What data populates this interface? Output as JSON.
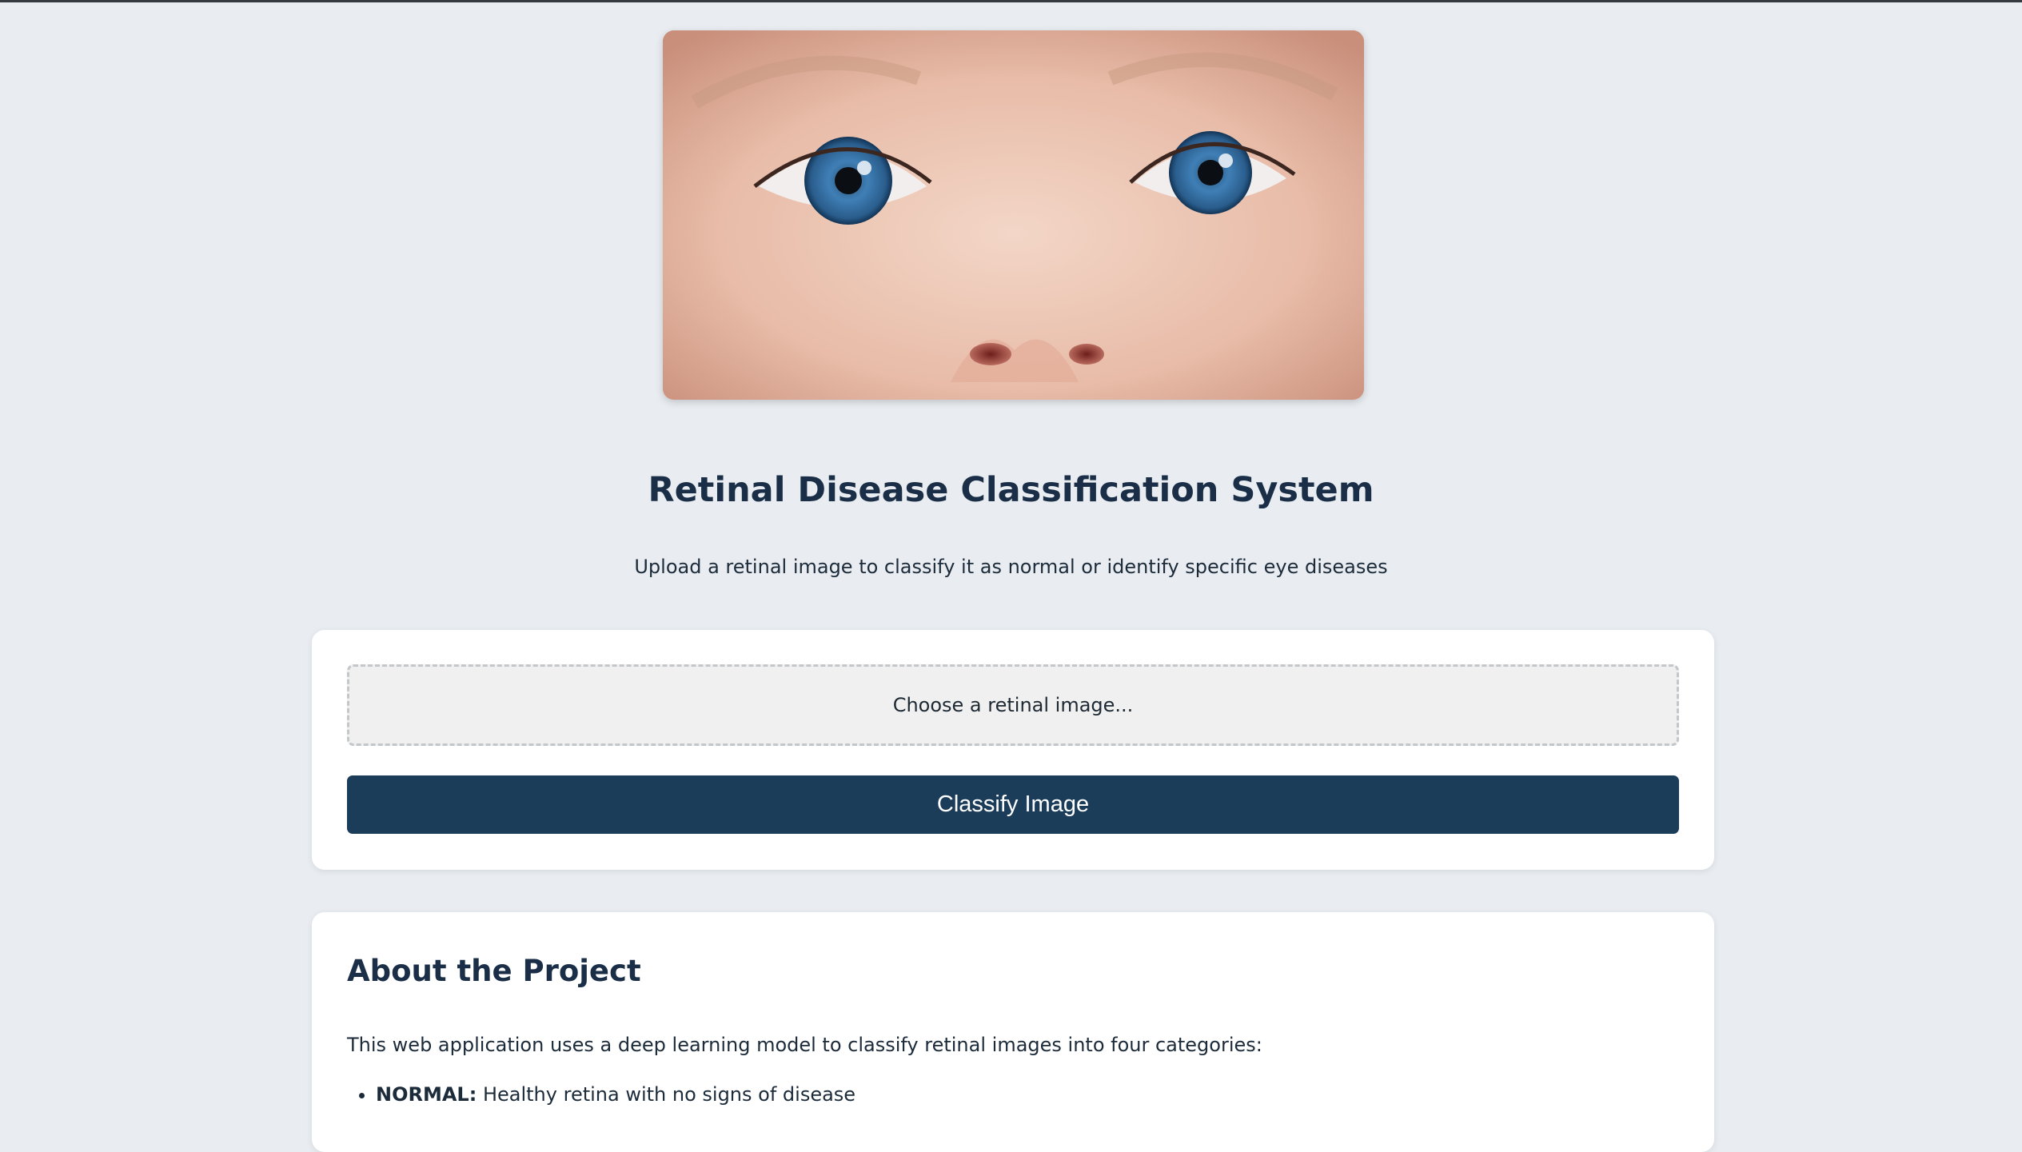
{
  "hero": {
    "image_name": "baby-blue-eyes"
  },
  "header": {
    "title": "Retinal Disease Classification System",
    "subtitle": "Upload a retinal image to classify it as normal or identify specific eye diseases"
  },
  "upload": {
    "file_label": "Choose a retinal image...",
    "button_label": "Classify Image"
  },
  "about": {
    "title": "About the Project",
    "description": "This web application uses a deep learning model to classify retinal images into four categories:",
    "categories": [
      {
        "name": "NORMAL:",
        "desc": " Healthy retina with no signs of disease"
      }
    ]
  },
  "colors": {
    "background": "#e9edf1",
    "primary": "#1c3d5a",
    "title": "#1a2f47"
  }
}
